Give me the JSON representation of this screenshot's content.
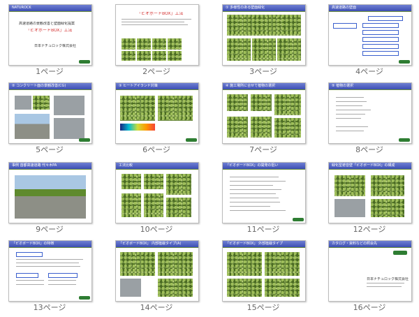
{
  "pages": [
    {
      "caption": "1ページ",
      "title": "NATUROCK",
      "line1": "高速道路の景観改善と壁面緑化提案",
      "line2": "「ビオボードBOX」工法",
      "company": "日本ナチュロック株式会社"
    },
    {
      "caption": "2ページ",
      "title": "「ビオボードBOX」工法"
    },
    {
      "caption": "3ページ",
      "title": "① 多様性のある壁面緑化"
    },
    {
      "caption": "4ページ",
      "title": "高速道路の壁面"
    },
    {
      "caption": "5ページ",
      "title": "② コンクリート面の景観改善(CG)"
    },
    {
      "caption": "6ページ",
      "title": "③ ヒートアイランド対策"
    },
    {
      "caption": "7ページ",
      "title": "④ 施工場所に合せて植物の選択"
    },
    {
      "caption": "8ページ",
      "title": "⑤ 植物の選択"
    },
    {
      "caption": "9ページ",
      "title": "事例 首都高速道路 代々木PA"
    },
    {
      "caption": "10ページ",
      "title": "工法比較"
    },
    {
      "caption": "11ページ",
      "title": "「ビオボードBOX」の開発の狙い"
    },
    {
      "caption": "12ページ",
      "title": "緑化型遮音壁「ビオボードBOX」の構成"
    },
    {
      "caption": "13ページ",
      "title": "「ビオボードBOX」の特徴"
    },
    {
      "caption": "14ページ",
      "title": "「ビオボードBOX」 内部植栽タイプ(A)"
    },
    {
      "caption": "15ページ",
      "title": "「ビオボードBOX」 外部植栽タイプ"
    },
    {
      "caption": "16ページ",
      "title": "カタログ・資料などの照会先",
      "company": "日本ナチュロック株式会社"
    }
  ],
  "colors": {
    "bar": "#4a5cc0",
    "accent_red": "#d32f2f",
    "logo_green": "#2e7d32"
  }
}
